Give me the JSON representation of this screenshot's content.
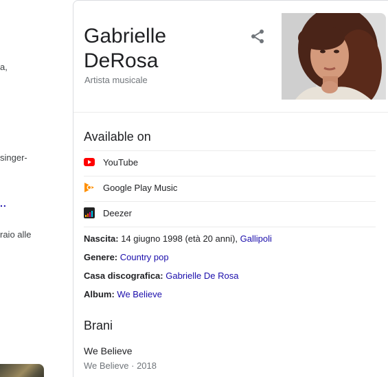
{
  "left_column": {
    "fragments": [
      "a,",
      "singer-",
      "..",
      "raio alle"
    ]
  },
  "panel": {
    "title_line1": "Gabrielle",
    "title_line2": "DeRosa",
    "subtitle": "Artista musicale",
    "available_on": {
      "heading": "Available on",
      "items": [
        {
          "label": "YouTube",
          "icon": "youtube-icon"
        },
        {
          "label": "Google Play Music",
          "icon": "google-play-music-icon"
        },
        {
          "label": "Deezer",
          "icon": "deezer-icon"
        }
      ]
    },
    "facts": {
      "birth": {
        "label": "Nascita:",
        "value": " 14 giugno 1998 (età 20 anni), ",
        "link": "Gallipoli"
      },
      "genre": {
        "label": "Genere:",
        "link": "Country pop"
      },
      "label": {
        "label": "Casa discografica:",
        "link": "Gabrielle De Rosa"
      },
      "album": {
        "label": "Album:",
        "link": "We Believe"
      }
    },
    "songs": {
      "heading": "Brani",
      "items": [
        {
          "title": "We Believe",
          "meta": "We Believe · 2018"
        }
      ]
    }
  },
  "colors": {
    "link": "#1a0dab",
    "youtube": "#ff0000",
    "play_music": "#ff8f00",
    "secondary_text": "#70757a"
  }
}
